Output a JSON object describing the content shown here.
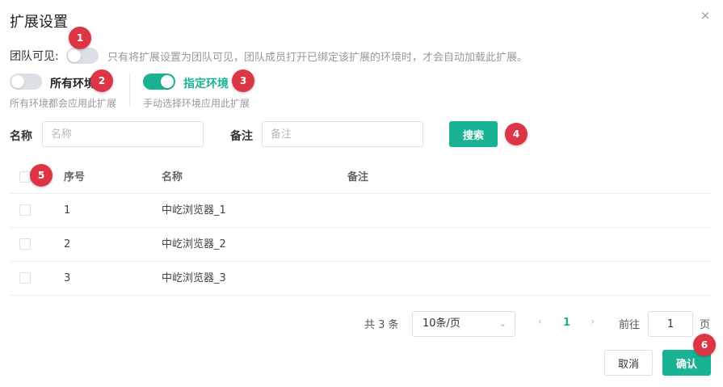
{
  "dialog": {
    "title": "扩展设置",
    "close_icon": "×"
  },
  "team_visible": {
    "label": "团队可见:",
    "enabled": false,
    "hint": "只有将扩展设置为团队可见，团队成员打开已绑定该扩展的环境时，才会自动加载此扩展。"
  },
  "environments": {
    "all": {
      "label": "所有环境",
      "desc": "所有环境都会应用此扩展",
      "enabled": false
    },
    "specific": {
      "label": "指定环境",
      "desc": "手动选择环境应用此扩展",
      "enabled": true
    }
  },
  "search": {
    "name_label": "名称",
    "name_placeholder": "名称",
    "remark_label": "备注",
    "remark_placeholder": "备注",
    "button_label": "搜索"
  },
  "table": {
    "columns": [
      "序号",
      "名称",
      "备注"
    ],
    "rows": [
      {
        "index": "1",
        "name": "中屹浏览器_1",
        "remark": ""
      },
      {
        "index": "2",
        "name": "中屹浏览器_2",
        "remark": ""
      },
      {
        "index": "3",
        "name": "中屹浏览器_3",
        "remark": ""
      }
    ]
  },
  "pagination": {
    "total_text": "共 3 条",
    "page_size": "10条/页",
    "prev_icon": "‹",
    "current_page": "1",
    "next_icon": "›",
    "goto_label": "前往",
    "goto_value": "1",
    "page_unit": "页"
  },
  "footer": {
    "cancel_label": "取消",
    "confirm_label": "确认"
  },
  "annotations": [
    "1",
    "2",
    "3",
    "4",
    "5",
    "6"
  ],
  "colors": {
    "accent": "#19b394",
    "badge": "#dc3545"
  }
}
